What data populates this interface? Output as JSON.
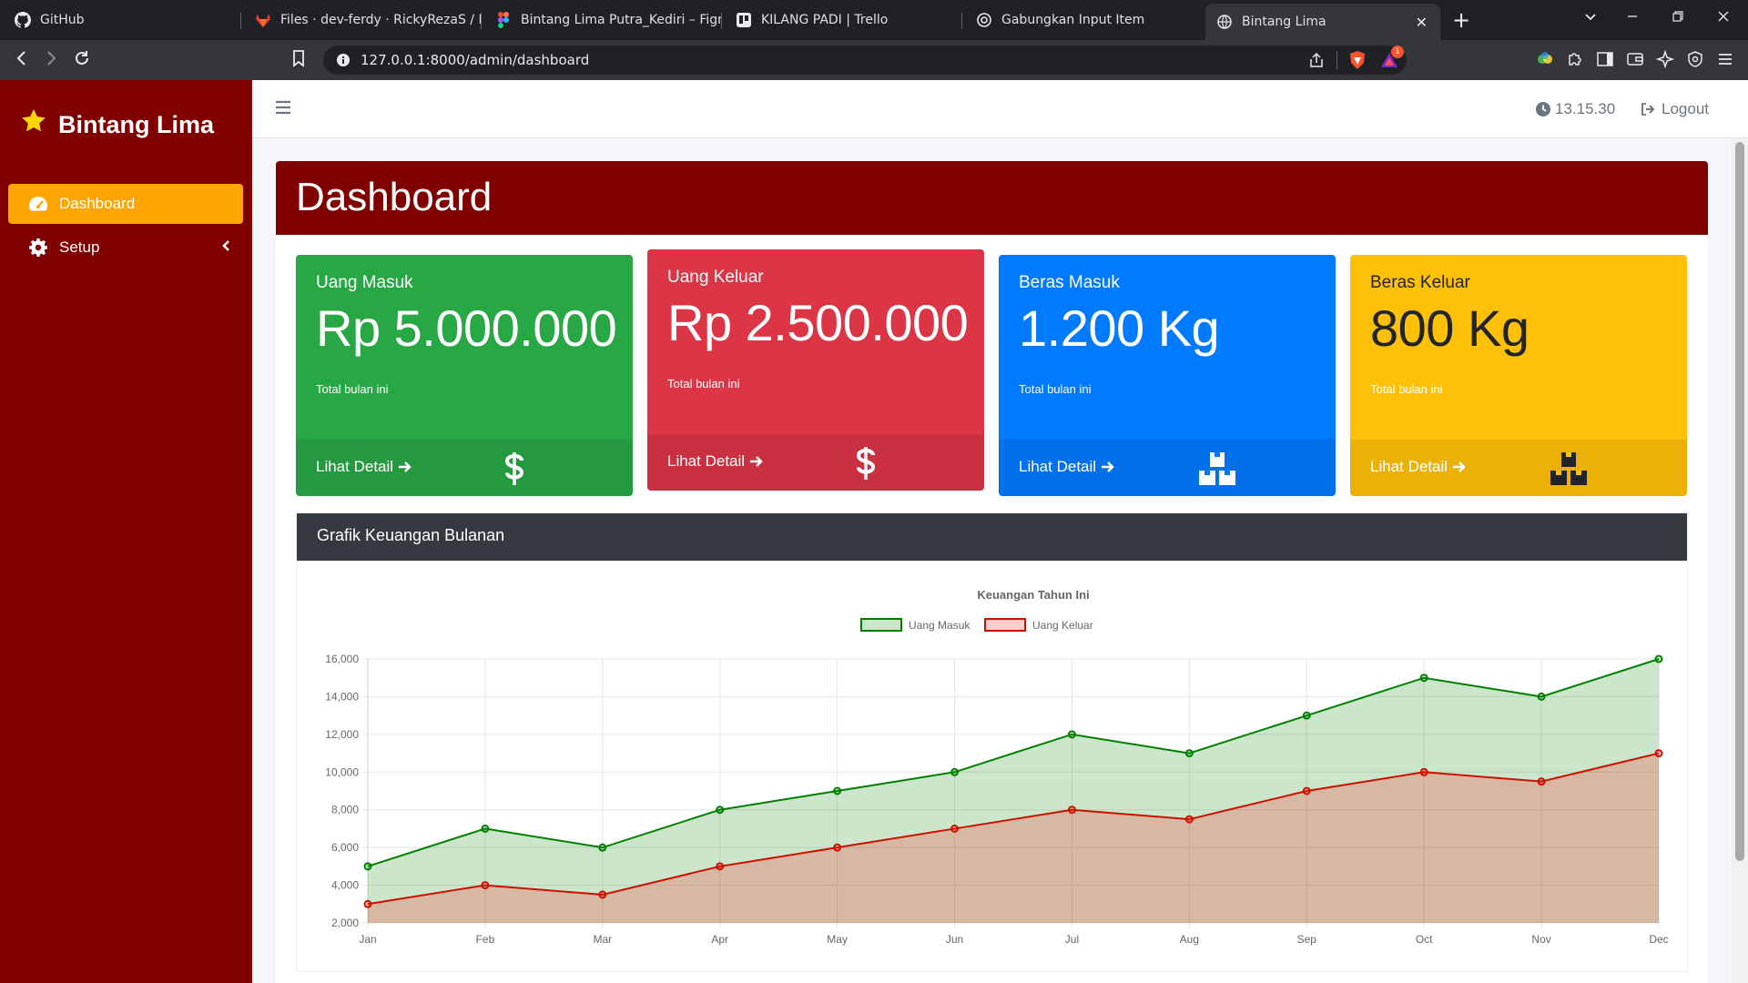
{
  "browser": {
    "tabs": [
      {
        "label": "GitHub",
        "icon": "github-icon"
      },
      {
        "label": "Files · dev-ferdy · RickyRezaS / Binta",
        "icon": "gitlab-icon"
      },
      {
        "label": "Bintang Lima Putra_Kediri – Figma",
        "icon": "figma-icon"
      },
      {
        "label": "KILANG PADI | Trello",
        "icon": "trello-icon"
      },
      {
        "label": "Gabungkan Input Item",
        "icon": "chatgpt-icon"
      },
      {
        "label": "Bintang Lima",
        "icon": "globe-icon"
      }
    ],
    "url": "127.0.0.1:8000/admin/dashboard",
    "brave_badge": "1"
  },
  "sidebar": {
    "brand": "Bintang Lima",
    "items": [
      {
        "label": "Dashboard",
        "icon": "tachometer-icon"
      },
      {
        "label": "Setup",
        "icon": "gear-icon"
      }
    ]
  },
  "topnav": {
    "time": "13.15.30",
    "logout": "Logout"
  },
  "page": {
    "title": "Dashboard"
  },
  "cards": [
    {
      "title": "Uang Masuk",
      "value": "Rp 5.000.000",
      "subtitle": "Total bulan ini",
      "link": "Lihat Detail",
      "icon": "dollar-icon",
      "color": "#28a745"
    },
    {
      "title": "Uang Keluar",
      "value": "Rp 2.500.000",
      "subtitle": "Total bulan ini",
      "link": "Lihat Detail",
      "icon": "dollar-icon",
      "color": "#dc3545"
    },
    {
      "title": "Beras Masuk",
      "value": "1.200 Kg",
      "subtitle": "Total bulan ini",
      "link": "Lihat Detail",
      "icon": "boxes-icon",
      "color": "#007bff"
    },
    {
      "title": "Beras Keluar",
      "value": "800 Kg",
      "subtitle": "Total bulan ini",
      "link": "Lihat Detail",
      "icon": "boxes-icon",
      "color": "#ffc107"
    }
  ],
  "chart_panel": {
    "header": "Grafik Keuangan Bulanan"
  },
  "chart_data": {
    "type": "area",
    "title": "Keuangan Tahun Ini",
    "categories": [
      "Jan",
      "Feb",
      "Mar",
      "Apr",
      "May",
      "Jun",
      "Jul",
      "Aug",
      "Sep",
      "Oct",
      "Nov",
      "Dec"
    ],
    "series": [
      {
        "name": "Uang Masuk",
        "values": [
          5000,
          7000,
          6000,
          8000,
          9000,
          10000,
          12000,
          11000,
          13000,
          15000,
          14000,
          16000
        ],
        "color": "#008000",
        "fill": "rgba(0,128,0,0.2)"
      },
      {
        "name": "Uang Keluar",
        "values": [
          3000,
          4000,
          3500,
          5000,
          6000,
          7000,
          8000,
          7500,
          9000,
          10000,
          9500,
          11000
        ],
        "color": "#cc1100",
        "fill": "rgba(255,0,0,0.2)"
      }
    ],
    "ylim": [
      2000,
      16000
    ],
    "yticks": [
      "16,000",
      "14,000",
      "12,000",
      "10,000",
      "8,000",
      "6,000",
      "4,000",
      "2,000"
    ],
    "legend": "top",
    "grid": true
  }
}
